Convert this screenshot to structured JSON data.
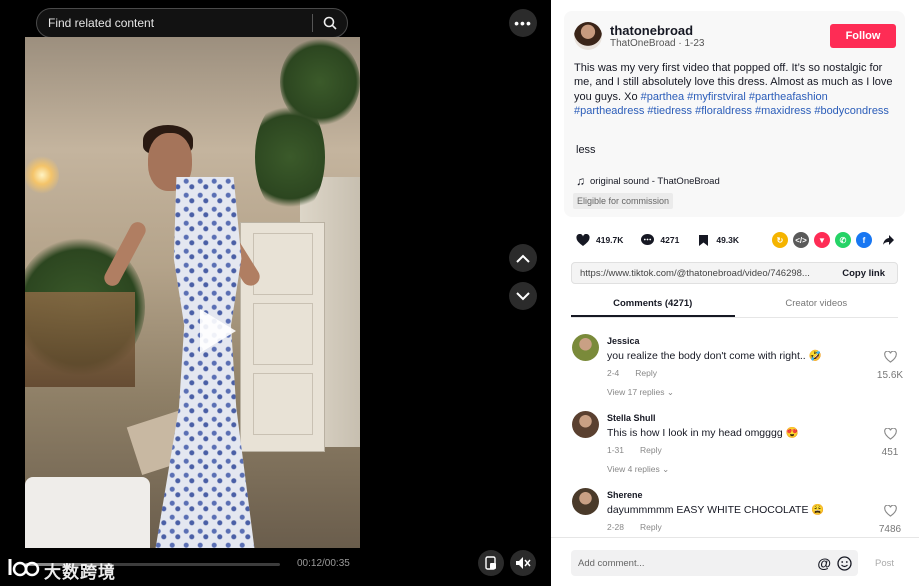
{
  "search": {
    "placeholder": "Find related content"
  },
  "video": {
    "time": "00:12/00:35",
    "progress_fraction": 0.34,
    "watermark": "大数跨境"
  },
  "author": {
    "display_name": "thatonebroad",
    "handle_date": "ThatOneBroad · 1-23",
    "follow_label": "Follow"
  },
  "caption": {
    "text": "This was my very first video that popped off. It’s so nostalgic for me, and I still absolutely love this dress. Almost as much as I love you guys. Xo ",
    "hashtags": [
      "#parthea",
      "#myfirstviral",
      "#partheafashion",
      "#partheadress",
      "#tiedress",
      "#floraldress",
      "#maxidress",
      "#bodycondress"
    ],
    "less_label": "less"
  },
  "sound": {
    "label": "original sound - ThatOneBroad"
  },
  "commission": {
    "label": "Eligible for commission"
  },
  "stats": {
    "likes": "419.7K",
    "comments": "4271",
    "saves": "49.3K"
  },
  "share_icons": [
    {
      "name": "repost-icon",
      "color": "#f5b400",
      "glyph": "↻"
    },
    {
      "name": "embed-icon",
      "color": "#5a5a5a",
      "glyph": "</>"
    },
    {
      "name": "send-icon",
      "color": "#fe2c55",
      "glyph": "▼"
    },
    {
      "name": "whatsapp-icon",
      "color": "#25d366",
      "glyph": "✆"
    },
    {
      "name": "facebook-icon",
      "color": "#1877f2",
      "glyph": "f"
    }
  ],
  "link": {
    "url": "https://www.tiktok.com/@thatonebroad/video/746298...",
    "copy_label": "Copy link"
  },
  "tabs": [
    {
      "label": "Comments (4271)",
      "active": true
    },
    {
      "label": "Creator videos",
      "active": false
    }
  ],
  "comments": [
    {
      "name": "Jessica",
      "text": "you realize the body don't come with right.. 🤣",
      "date": "2-4",
      "reply": "Reply",
      "replies": "View 17 replies ⌄",
      "likes": "15.6K",
      "avatar_color": "#7a8a3a"
    },
    {
      "name": "Stella Shull",
      "text": "This is how I look in my head omgggg 😍",
      "date": "1-31",
      "reply": "Reply",
      "replies": "View 4 replies ⌄",
      "likes": "451",
      "avatar_color": "#5a4030"
    },
    {
      "name": "Sherene",
      "text": "dayummmmm EASY WHITE CHOCOLATE 😩",
      "date": "2-28",
      "reply": "Reply",
      "replies": "",
      "likes": "7486",
      "avatar_color": "#4a3a2a"
    }
  ],
  "composer": {
    "placeholder": "Add comment...",
    "at_symbol": "@",
    "post_label": "Post"
  }
}
